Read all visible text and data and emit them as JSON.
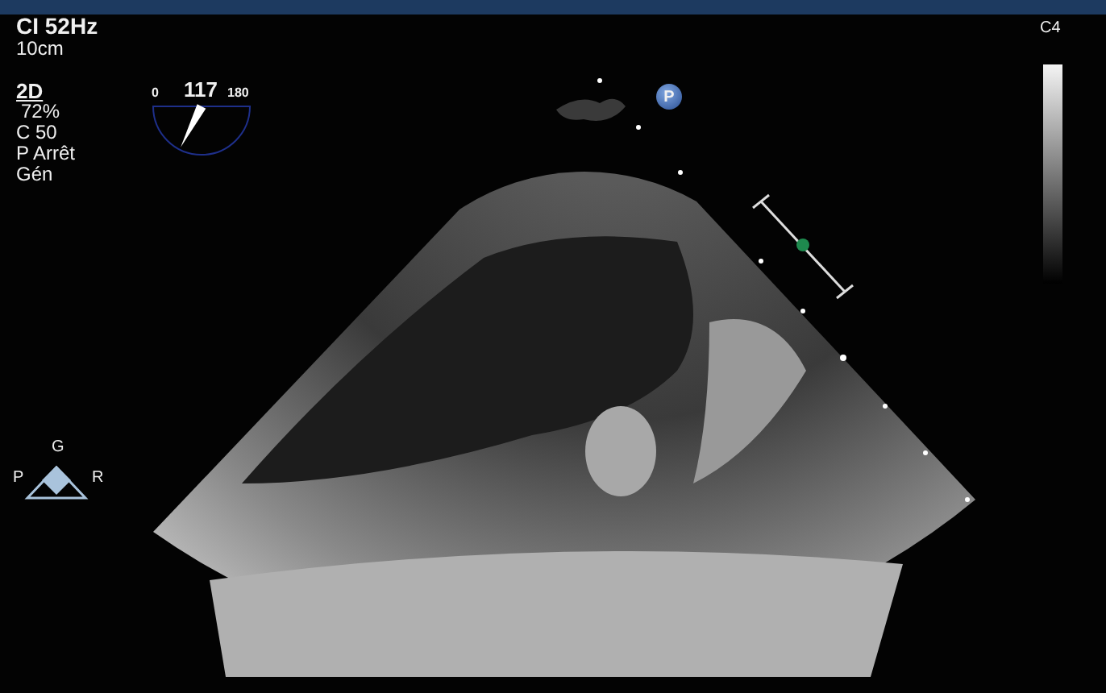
{
  "header": {
    "frequency": "CI 52Hz",
    "depth": "10cm"
  },
  "mode": {
    "label": "2D",
    "gain": "72%",
    "compression": "C 50",
    "persistence": "P Arrêt",
    "resolution": "Gén"
  },
  "angle": {
    "min": "0",
    "value": "117",
    "max": "180"
  },
  "probe_marker": "P",
  "grayscale_map": "C4",
  "orientation": {
    "top": "G",
    "left": "P",
    "right": "R"
  }
}
